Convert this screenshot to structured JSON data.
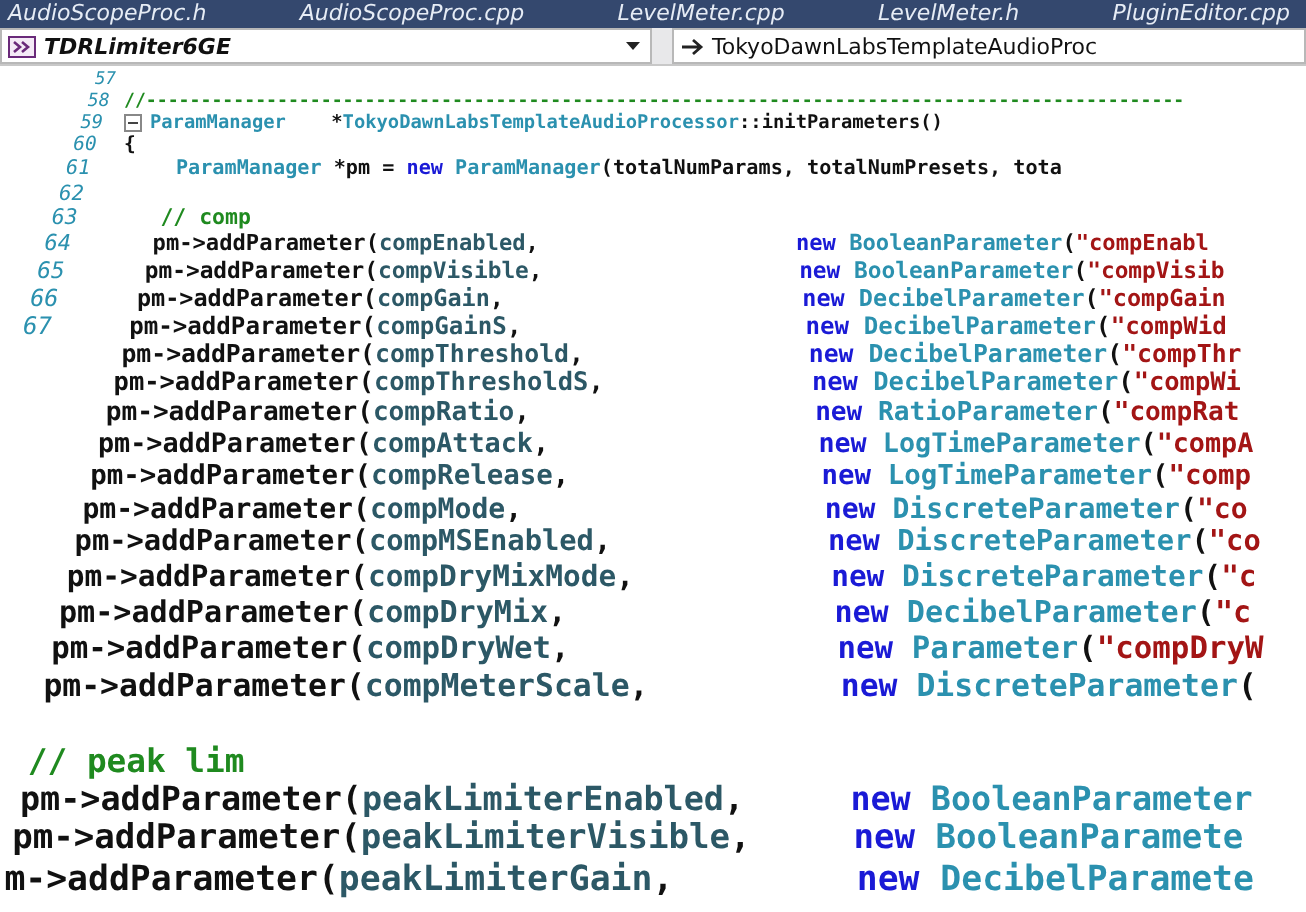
{
  "tabs": [
    {
      "label": "AudioScopeProc.h"
    },
    {
      "label": "AudioScopeProc.cpp"
    },
    {
      "label": "LevelMeter.cpp"
    },
    {
      "label": "LevelMeter.h"
    },
    {
      "label": "PluginEditor.cpp"
    }
  ],
  "nav": {
    "project": "TDRLimiter6GE",
    "member": "TokyoDawnLabsTemplateAudioProc"
  },
  "lines": [
    {
      "number": "57",
      "fold": false
    },
    {
      "number": "58",
      "fold": false,
      "code": [
        {
          "kind": "comment",
          "text": "//-----------------------------------------------------------------------------------------------"
        }
      ]
    },
    {
      "number": "59",
      "fold": true,
      "code": [
        {
          "kind": "type",
          "text": "ParamManager"
        },
        {
          "kind": "plain",
          "text": "    *"
        },
        {
          "kind": "type",
          "text": "TokyoDawnLabsTemplateAudioProcessor"
        },
        {
          "kind": "plain",
          "text": "::initParameters()"
        }
      ]
    },
    {
      "number": "60",
      "fold": false,
      "code": [
        {
          "kind": "plain",
          "text": "{"
        }
      ]
    },
    {
      "number": "61",
      "fold": false,
      "code": [
        {
          "kind": "type",
          "text": "ParamManager"
        },
        {
          "kind": "plain",
          "text": " *pm = "
        },
        {
          "kind": "keyword",
          "text": "new"
        },
        {
          "kind": "type",
          "text": " ParamManager"
        },
        {
          "kind": "plain",
          "text": "(totalNumParams, totalNumPresets, tota"
        }
      ]
    },
    {
      "number": "62",
      "fold": false
    },
    {
      "number": "63",
      "fold": false,
      "code": [
        {
          "kind": "comment",
          "text": "// comp"
        }
      ]
    },
    {
      "number": "64",
      "fold": false,
      "code": [
        {
          "kind": "plain",
          "text": "pm->addParameter("
        },
        {
          "kind": "ident",
          "text": "compEnabled"
        },
        {
          "kind": "plain",
          "text": ","
        }
      ],
      "tail": [
        {
          "kind": "keyword",
          "text": "new"
        },
        {
          "kind": "type",
          "text": " BooleanParameter"
        },
        {
          "kind": "plain",
          "text": "("
        },
        {
          "kind": "string",
          "text": "\"compEnabl"
        }
      ]
    },
    {
      "number": "65",
      "fold": false,
      "code": [
        {
          "kind": "plain",
          "text": "pm->addParameter("
        },
        {
          "kind": "ident",
          "text": "compVisible"
        },
        {
          "kind": "plain",
          "text": ","
        }
      ],
      "tail": [
        {
          "kind": "keyword",
          "text": "new"
        },
        {
          "kind": "type",
          "text": " BooleanParameter"
        },
        {
          "kind": "plain",
          "text": "("
        },
        {
          "kind": "string",
          "text": "\"compVisib"
        }
      ]
    },
    {
      "number": "66",
      "fold": false,
      "code": [
        {
          "kind": "plain",
          "text": "pm->addParameter("
        },
        {
          "kind": "ident",
          "text": "compGain"
        },
        {
          "kind": "plain",
          "text": ","
        }
      ],
      "tail": [
        {
          "kind": "keyword",
          "text": "new"
        },
        {
          "kind": "type",
          "text": " DecibelParameter"
        },
        {
          "kind": "plain",
          "text": "("
        },
        {
          "kind": "string",
          "text": "\"compGain"
        }
      ]
    },
    {
      "number": "67",
      "fold": false,
      "code": [
        {
          "kind": "plain",
          "text": "pm->addParameter("
        },
        {
          "kind": "ident",
          "text": "compGainS"
        },
        {
          "kind": "plain",
          "text": ","
        }
      ],
      "tail": [
        {
          "kind": "keyword",
          "text": "new"
        },
        {
          "kind": "type",
          "text": " DecibelParameter"
        },
        {
          "kind": "plain",
          "text": "("
        },
        {
          "kind": "string",
          "text": "\"compWid"
        }
      ]
    },
    {
      "code": [
        {
          "kind": "plain",
          "text": "pm->addParameter("
        },
        {
          "kind": "ident",
          "text": "compThreshold"
        },
        {
          "kind": "plain",
          "text": ","
        }
      ],
      "tail": [
        {
          "kind": "keyword",
          "text": "new"
        },
        {
          "kind": "type",
          "text": " DecibelParameter"
        },
        {
          "kind": "plain",
          "text": "("
        },
        {
          "kind": "string",
          "text": "\"compThr"
        }
      ]
    },
    {
      "code": [
        {
          "kind": "plain",
          "text": "pm->addParameter("
        },
        {
          "kind": "ident",
          "text": "compThresholdS"
        },
        {
          "kind": "plain",
          "text": ","
        }
      ],
      "tail": [
        {
          "kind": "keyword",
          "text": "new"
        },
        {
          "kind": "type",
          "text": " DecibelParameter"
        },
        {
          "kind": "plain",
          "text": "("
        },
        {
          "kind": "string",
          "text": "\"compWi"
        }
      ]
    },
    {
      "code": [
        {
          "kind": "plain",
          "text": "pm->addParameter("
        },
        {
          "kind": "ident",
          "text": "compRatio"
        },
        {
          "kind": "plain",
          "text": ","
        }
      ],
      "tail": [
        {
          "kind": "keyword",
          "text": "new"
        },
        {
          "kind": "type",
          "text": " RatioParameter"
        },
        {
          "kind": "plain",
          "text": "("
        },
        {
          "kind": "string",
          "text": "\"compRat"
        }
      ]
    },
    {
      "code": [
        {
          "kind": "plain",
          "text": "pm->addParameter("
        },
        {
          "kind": "ident",
          "text": "compAttack"
        },
        {
          "kind": "plain",
          "text": ","
        }
      ],
      "tail": [
        {
          "kind": "keyword",
          "text": "new"
        },
        {
          "kind": "type",
          "text": " LogTimeParameter"
        },
        {
          "kind": "plain",
          "text": "("
        },
        {
          "kind": "string",
          "text": "\"compA"
        }
      ]
    },
    {
      "code": [
        {
          "kind": "plain",
          "text": "pm->addParameter("
        },
        {
          "kind": "ident",
          "text": "compRelease"
        },
        {
          "kind": "plain",
          "text": ","
        }
      ],
      "tail": [
        {
          "kind": "keyword",
          "text": "new"
        },
        {
          "kind": "type",
          "text": " LogTimeParameter"
        },
        {
          "kind": "plain",
          "text": "("
        },
        {
          "kind": "string",
          "text": "\"comp"
        }
      ]
    },
    {
      "code": [
        {
          "kind": "plain",
          "text": "pm->addParameter("
        },
        {
          "kind": "ident",
          "text": "compMode"
        },
        {
          "kind": "plain",
          "text": ","
        }
      ],
      "tail": [
        {
          "kind": "keyword",
          "text": "new"
        },
        {
          "kind": "type",
          "text": " DiscreteParameter"
        },
        {
          "kind": "plain",
          "text": "("
        },
        {
          "kind": "string",
          "text": "\"co"
        }
      ]
    },
    {
      "code": [
        {
          "kind": "plain",
          "text": "pm->addParameter("
        },
        {
          "kind": "ident",
          "text": "compMSEnabled"
        },
        {
          "kind": "plain",
          "text": ","
        }
      ],
      "tail": [
        {
          "kind": "keyword",
          "text": "new"
        },
        {
          "kind": "type",
          "text": " DiscreteParameter"
        },
        {
          "kind": "plain",
          "text": "("
        },
        {
          "kind": "string",
          "text": "\"co"
        }
      ]
    },
    {
      "code": [
        {
          "kind": "plain",
          "text": "pm->addParameter("
        },
        {
          "kind": "ident",
          "text": "compDryMixMode"
        },
        {
          "kind": "plain",
          "text": ","
        }
      ],
      "tail": [
        {
          "kind": "keyword",
          "text": "new"
        },
        {
          "kind": "type",
          "text": " DiscreteParameter"
        },
        {
          "kind": "plain",
          "text": "("
        },
        {
          "kind": "string",
          "text": "\"c"
        }
      ]
    },
    {
      "code": [
        {
          "kind": "plain",
          "text": "pm->addParameter("
        },
        {
          "kind": "ident",
          "text": "compDryMix"
        },
        {
          "kind": "plain",
          "text": ","
        }
      ],
      "tail": [
        {
          "kind": "keyword",
          "text": "new"
        },
        {
          "kind": "type",
          "text": " DecibelParameter"
        },
        {
          "kind": "plain",
          "text": "("
        },
        {
          "kind": "string",
          "text": "\"c"
        }
      ]
    },
    {
      "code": [
        {
          "kind": "plain",
          "text": "pm->addParameter("
        },
        {
          "kind": "ident",
          "text": "compDryWet"
        },
        {
          "kind": "plain",
          "text": ","
        }
      ],
      "tail": [
        {
          "kind": "keyword",
          "text": "new"
        },
        {
          "kind": "type",
          "text": " Parameter"
        },
        {
          "kind": "plain",
          "text": "("
        },
        {
          "kind": "string",
          "text": "\"compDryW"
        }
      ]
    },
    {
      "code": [
        {
          "kind": "plain",
          "text": "pm->addParameter("
        },
        {
          "kind": "ident",
          "text": "compMeterScale"
        },
        {
          "kind": "plain",
          "text": ","
        }
      ],
      "tail": [
        {
          "kind": "keyword",
          "text": "new"
        },
        {
          "kind": "type",
          "text": " DiscreteParameter"
        },
        {
          "kind": "plain",
          "text": "("
        }
      ]
    },
    {
      "code": [
        {
          "kind": "comment",
          "text": "// peak lim"
        }
      ]
    },
    {
      "code": [
        {
          "kind": "plain",
          "text": "pm->addParameter("
        },
        {
          "kind": "ident",
          "text": "peakLimiterEnabled"
        },
        {
          "kind": "plain",
          "text": ","
        }
      ],
      "tail": [
        {
          "kind": "keyword",
          "text": "new"
        },
        {
          "kind": "type",
          "text": " BooleanParameter"
        }
      ]
    },
    {
      "code": [
        {
          "kind": "plain",
          "text": "pm->addParameter("
        },
        {
          "kind": "ident",
          "text": "peakLimiterVisible"
        },
        {
          "kind": "plain",
          "text": ","
        }
      ],
      "tail": [
        {
          "kind": "keyword",
          "text": "new"
        },
        {
          "kind": "type",
          "text": " BooleanParamete"
        }
      ]
    },
    {
      "code": [
        {
          "kind": "plain",
          "text": "m->addParameter("
        },
        {
          "kind": "ident",
          "text": "peakLimiterGain"
        },
        {
          "kind": "plain",
          "text": ","
        }
      ],
      "tail": [
        {
          "kind": "keyword",
          "text": "new"
        },
        {
          "kind": "type",
          "text": " DecibelParamete"
        }
      ]
    }
  ]
}
